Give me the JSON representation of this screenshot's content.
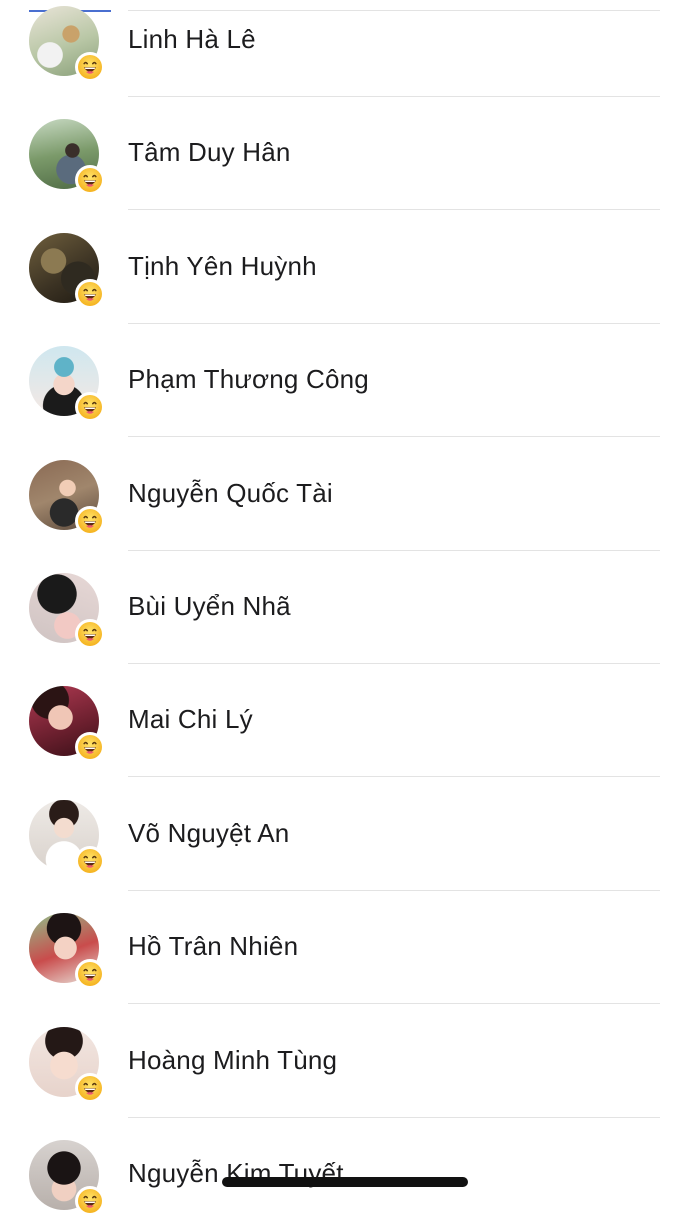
{
  "reaction_icon": "laughing-face-icon",
  "accent_color": "#4a6fd0",
  "people": [
    {
      "name": "Linh Hà Lê"
    },
    {
      "name": "Tâm Duy Hân"
    },
    {
      "name": "Tịnh Yên Huỳnh"
    },
    {
      "name": "Phạm Thương Công"
    },
    {
      "name": "Nguyễn Quốc Tài"
    },
    {
      "name": "Bùi Uyển Nhã"
    },
    {
      "name": "Mai Chi Lý"
    },
    {
      "name": "Võ Nguyệt An"
    },
    {
      "name": "Hồ Trân Nhiên"
    },
    {
      "name": "Hoàng Minh Tùng"
    },
    {
      "name": "Nguyễn Kim Tuyết"
    }
  ]
}
